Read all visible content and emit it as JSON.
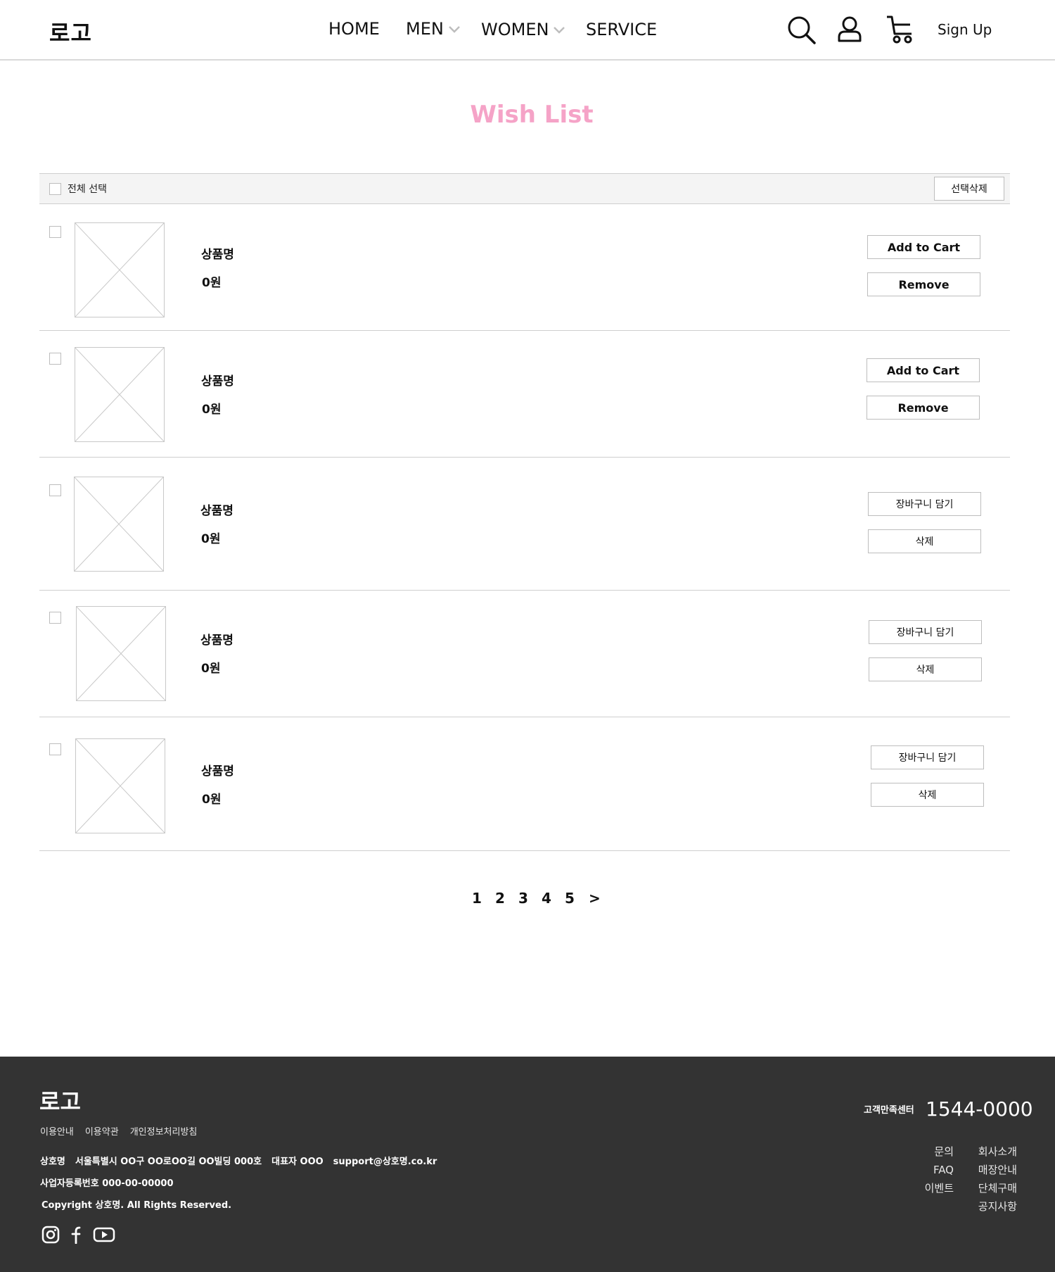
{
  "header": {
    "logo": "로고",
    "nav": [
      {
        "label": "HOME",
        "dropdown": false
      },
      {
        "label": "MEN",
        "dropdown": true
      },
      {
        "label": "WOMEN",
        "dropdown": true
      },
      {
        "label": "SERVICE",
        "dropdown": false
      }
    ],
    "icons": [
      "search-icon",
      "user-icon",
      "cart-icon"
    ],
    "signup_label": "Sign Up"
  },
  "page": {
    "title": "Wish List",
    "title_color": "#f5a3c7"
  },
  "select_bar": {
    "select_all_label": "전체 선택",
    "delete_selected_label": "선택삭제"
  },
  "items": [
    {
      "name": "상품명",
      "price": "0원",
      "cart_label": "Add to Cart",
      "remove_label": "Remove"
    },
    {
      "name": "상품명",
      "price": "0원",
      "cart_label": "Add to Cart",
      "remove_label": "Remove"
    },
    {
      "name": "상품명",
      "price": "0원",
      "cart_label": "장바구니 담기",
      "remove_label": "삭제"
    },
    {
      "name": "상품명",
      "price": "0원",
      "cart_label": "장바구니 담기",
      "remove_label": "삭제"
    },
    {
      "name": "상품명",
      "price": "0원",
      "cart_label": "장바구니 담기",
      "remove_label": "삭제"
    }
  ],
  "pagination": {
    "pages": [
      "1",
      "2",
      "3",
      "4",
      "5"
    ],
    "next": ">"
  },
  "footer": {
    "logo": "로고",
    "links": [
      "이용안내",
      "이용약관",
      "개인정보처리방침"
    ],
    "company": "상호명",
    "address": "서울특별시 OO구 OO로OO길 OO빌딩 000호",
    "ceo": "대표자 OOO",
    "email": "support@상호명.co.kr",
    "biz_number": "사업자등록번호 000-00-00000",
    "copyright": "Copyright 상호명. All Rights Reserved.",
    "social_icons": [
      "instagram-icon",
      "facebook-icon",
      "youtube-icon"
    ],
    "cs_label": "고객만족센터",
    "cs_phone": "1544-0000",
    "menu_col1": [
      "문의",
      "FAQ",
      "이벤트"
    ],
    "menu_col2": [
      "회사소개",
      "매장안내",
      "단체구매",
      "공지사항"
    ],
    "background": "#333333"
  }
}
